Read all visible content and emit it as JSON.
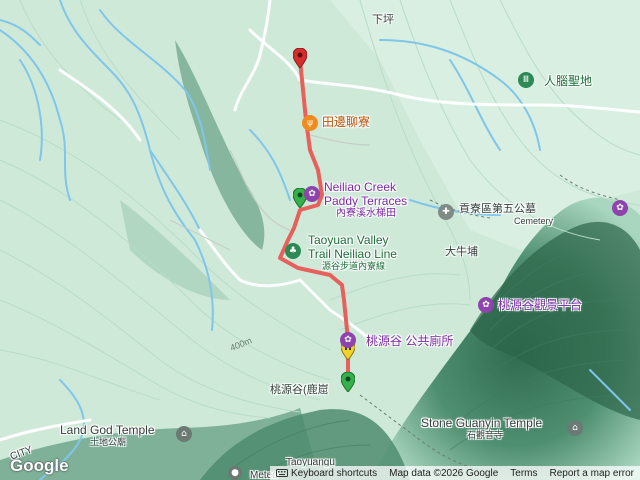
{
  "map": {
    "place_labels": {
      "xiaping": "下坪",
      "renao_sheng_di": "人腦聖地",
      "tianbian_liaoliao": "田邊聊寮",
      "neiliao_creek_en_1": "Neiliao Creek",
      "neiliao_creek_en_2": "Paddy Terraces",
      "neiliao_creek_zh": "內寮溪水梯田",
      "gongliao_cemetery_zh": "貢寮區第五公墓",
      "cemetery_en": "Cemetery",
      "taoyuan_trail_en_1": "Taoyuan Valley",
      "taoyuan_trail_en_2": "Trail Neiliao Line",
      "taoyuan_trail_zh": "源谷步道內寮線",
      "daniupu": "大牛埔",
      "taoyuangu_viewpoint": "桃源谷觀景平台",
      "taoyuangu_toilet": "桃源谷 公共廁所",
      "taoyuangu_luku": "桃源谷(鹿崫",
      "land_god_en": "Land God Temple",
      "land_god_zh": "土地公廟",
      "stone_guanyin_en": "Stone Guanyin Temple",
      "stone_guanyin_zh": "石觀音寺",
      "elevation_400": "400m",
      "city_partial": "CITY",
      "bottom_partial": "Taoyuangu",
      "bottom_partial_2": "Meteo"
    },
    "icons": {
      "renao": "monument-icon",
      "tianbian": "restaurant-icon",
      "neiliao_creek": "attraction-icon",
      "cemetery": "cemetery-icon",
      "taoyuan_trail": "park-icon",
      "viewpoint": "attraction-icon",
      "toilet": "attraction-icon",
      "land_god": "temple-icon",
      "stone_guanyin": "temple-icon"
    },
    "route_color": "#e8605c",
    "colors": {
      "terrain_light": "#cfe9d9",
      "terrain_dark": "#2a6b4d",
      "water": "#7fc6ea",
      "purple_label": "#7b2aa6",
      "marker_red": "#d62e2e",
      "marker_green": "#36b04a",
      "marker_yellow": "#f1d12b"
    }
  },
  "attribution": {
    "keyboard_shortcuts": "Keyboard shortcuts",
    "map_data": "Map data ©2026 Google",
    "terms": "Terms",
    "report": "Report a map error"
  },
  "logo": "Google"
}
